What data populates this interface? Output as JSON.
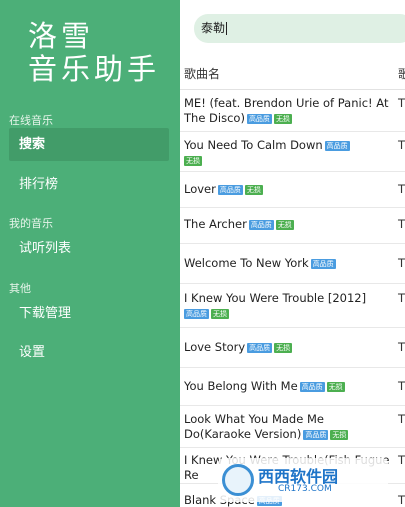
{
  "app": {
    "title_line1": "洛雪",
    "title_line2": "音乐助手"
  },
  "sidebar": {
    "sections": [
      {
        "label": "在线音乐",
        "items": [
          "搜索",
          "排行榜"
        ]
      },
      {
        "label": "我的音乐",
        "items": [
          "试听列表"
        ]
      },
      {
        "label": "其他",
        "items": [
          "下载管理",
          "设置"
        ]
      }
    ],
    "active_item": "搜索"
  },
  "search": {
    "value": "泰勒"
  },
  "table": {
    "headers": [
      "歌曲名",
      "歌"
    ],
    "rows": [
      {
        "title": "ME! (feat. Brendon Urie of Panic! At The Disco)",
        "hq": "高品质",
        "nl": "无损",
        "col2": "T"
      },
      {
        "title": "You Need To Calm Down",
        "hq": "高品质",
        "nl": "无损",
        "col2": "T"
      },
      {
        "title": "Lover",
        "hq": "高品质",
        "nl": "无损",
        "col2": "T"
      },
      {
        "title": "The Archer",
        "hq": "高品质",
        "nl": "无损",
        "col2": "T"
      },
      {
        "title": "Welcome To New York",
        "hq": "高品质",
        "nl": "",
        "col2": "T"
      },
      {
        "title": "I Knew You Were Trouble [2012]",
        "hq": "高品质",
        "nl": "无损",
        "col2": "T"
      },
      {
        "title": "Love Story",
        "hq": "高品质",
        "nl": "无损",
        "col2": "T"
      },
      {
        "title": "You Belong With Me",
        "hq": "高品质",
        "nl": "无损",
        "col2": "T"
      },
      {
        "title": "Look What You Made Me Do(Karaoke Version)",
        "hq": "高品质",
        "nl": "无损",
        "col2": "T"
      },
      {
        "title": "I Knew You Were Trouble(Fish Fugue Re",
        "hq": "",
        "nl": "",
        "col2": "T"
      },
      {
        "title": "Blank Space",
        "hq": "高品质",
        "nl": "",
        "col2": "T"
      }
    ]
  },
  "watermark": {
    "text": "西西软件园",
    "url": "CR173.COM"
  }
}
